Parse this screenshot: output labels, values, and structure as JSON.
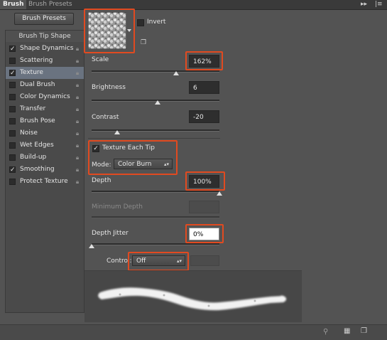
{
  "tabs": [
    {
      "label": "Brush",
      "active": true
    },
    {
      "label": "Brush Presets",
      "active": false
    }
  ],
  "window_controls": {
    "collapse_icon": "double-chevron-right-icon",
    "menu_icon": "panel-menu-icon",
    "collapse": "▸▸",
    "menu": "|≡"
  },
  "brush_presets_button": "Brush Presets",
  "sidebar": {
    "header": "Brush Tip Shape",
    "items": [
      {
        "label": "Shape Dynamics",
        "checked": true,
        "selected": false
      },
      {
        "label": "Scattering",
        "checked": false,
        "selected": false
      },
      {
        "label": "Texture",
        "checked": true,
        "selected": true
      },
      {
        "label": "Dual Brush",
        "checked": false,
        "selected": false
      },
      {
        "label": "Color Dynamics",
        "checked": false,
        "selected": false
      },
      {
        "label": "Transfer",
        "checked": false,
        "selected": false
      },
      {
        "label": "Brush Pose",
        "checked": false,
        "selected": false
      },
      {
        "label": "Noise",
        "checked": false,
        "selected": false
      },
      {
        "label": "Wet Edges",
        "checked": false,
        "selected": false
      },
      {
        "label": "Build-up",
        "checked": false,
        "selected": false
      },
      {
        "label": "Smoothing",
        "checked": true,
        "selected": false
      },
      {
        "label": "Protect Texture",
        "checked": false,
        "selected": false
      }
    ]
  },
  "texture": {
    "invert_label": "Invert",
    "invert_checked": false,
    "scale_label": "Scale",
    "scale_value": "162%",
    "scale_level": 0.5,
    "brightness_label": "Brightness",
    "brightness_value": "6",
    "brightness_level": 0.5,
    "contrast_label": "Contrast",
    "contrast_value": "-20",
    "contrast_level": 0.2,
    "texture_each_tip_label": "Texture Each Tip",
    "texture_each_tip_checked": true,
    "mode_label": "Mode:",
    "mode_value": "Color Burn",
    "depth_label": "Depth",
    "depth_value": "100%",
    "depth_level": 1.0,
    "min_depth_label": "Minimum Depth",
    "min_depth_value": "",
    "depth_jitter_label": "Depth Jitter",
    "depth_jitter_value": "0%",
    "depth_jitter_level": 0.0,
    "control_label": "Control:",
    "control_value": "Off"
  },
  "colors": {
    "highlight": "#e14a20",
    "selected_row": "#6a7380",
    "panel": "#535353"
  }
}
